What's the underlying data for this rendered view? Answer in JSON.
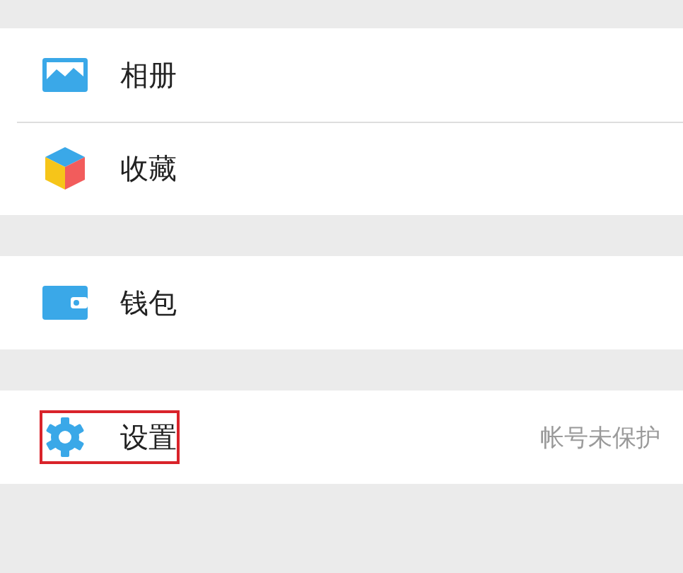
{
  "groups": [
    {
      "items": [
        {
          "kind": "album",
          "label": "相册",
          "highlighted": false
        },
        {
          "kind": "favorites",
          "label": "收藏",
          "highlighted": false
        }
      ]
    },
    {
      "items": [
        {
          "kind": "wallet",
          "label": "钱包",
          "highlighted": false
        }
      ]
    },
    {
      "items": [
        {
          "kind": "settings",
          "label": "设置",
          "highlighted": true,
          "note": "帐号未保护"
        }
      ]
    }
  ]
}
